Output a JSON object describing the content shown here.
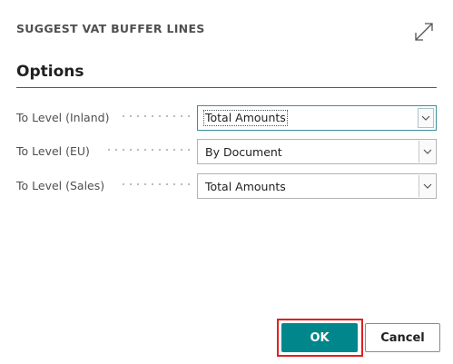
{
  "dialog": {
    "title": "SUGGEST VAT BUFFER LINES",
    "section_title": "Options"
  },
  "fields": [
    {
      "label": "To Level (Inland)",
      "value": "Total Amounts"
    },
    {
      "label": "To Level (EU)",
      "value": "By Document"
    },
    {
      "label": "To Level (Sales)",
      "value": "Total Amounts"
    }
  ],
  "buttons": {
    "ok_label": "OK",
    "cancel_label": "Cancel"
  },
  "colors": {
    "accent": "#00868b",
    "highlight_outline": "#e02020"
  },
  "icons": {
    "expand": "expand-diagonal-arrows-icon",
    "dropdown": "chevron-down-icon"
  }
}
